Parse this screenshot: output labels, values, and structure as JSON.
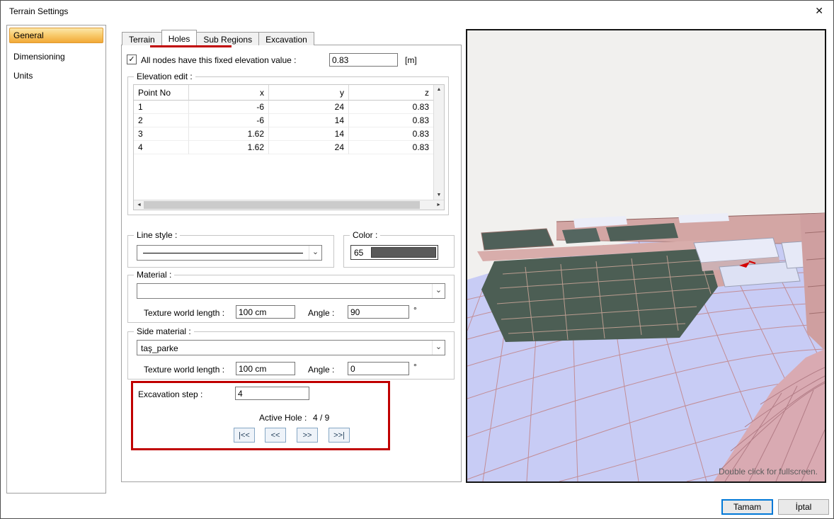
{
  "window": {
    "title": "Terrain Settings"
  },
  "icons": {
    "close": "✕",
    "check": "✓",
    "combo_arrow": "⌄",
    "scroll_up": "▲",
    "scroll_down": "▼",
    "scroll_left": "◄",
    "scroll_right": "►"
  },
  "colors": {
    "annotation_red": "#c00000",
    "color_swatch": "#5a5a5a",
    "sidebar_selected_orange": "#f2a937",
    "ok_button_focus_border": "#0078d7"
  },
  "sidebar": {
    "items": [
      {
        "label": "General",
        "selected": true
      },
      {
        "label": "Dimensioning",
        "selected": false
      },
      {
        "label": "Units",
        "selected": false
      }
    ]
  },
  "tabs": [
    {
      "label": "Terrain",
      "active": false
    },
    {
      "label": "Holes",
      "active": true
    },
    {
      "label": "Sub Regions",
      "active": false
    },
    {
      "label": "Excavation",
      "active": false
    }
  ],
  "fixed_elevation": {
    "label": "All nodes have this fixed elevation value :",
    "checked": true,
    "value": "0.83",
    "unit": "[m]"
  },
  "elevation_edit": {
    "legend": "Elevation edit :",
    "columns": [
      "Point No",
      "x",
      "y",
      "z"
    ],
    "rows": [
      [
        "1",
        "-6",
        "24",
        "0.83"
      ],
      [
        "2",
        "-6",
        "14",
        "0.83"
      ],
      [
        "3",
        "1.62",
        "14",
        "0.83"
      ],
      [
        "4",
        "1.62",
        "24",
        "0.83"
      ]
    ]
  },
  "line_style": {
    "legend": "Line style :"
  },
  "color": {
    "legend": "Color :",
    "value": "65",
    "swatch_hex": "#5a5a5a"
  },
  "material": {
    "legend": "Material :",
    "value": "",
    "texture_label": "Texture world length :",
    "texture_value": "100 cm",
    "angle_label": "Angle :",
    "angle_value": "90",
    "degree": "°"
  },
  "side_material": {
    "legend": "Side material :",
    "value": "taş_parke",
    "texture_label": "Texture world length :",
    "texture_value": "100 cm",
    "angle_label": "Angle :",
    "angle_value": "0",
    "degree": "°"
  },
  "excavation_nav": {
    "step_label": "Excavation step :",
    "step_value": "4",
    "active_hole_label": "Active Hole :",
    "active_hole_value": "4 / 9",
    "buttons": [
      "|<<",
      "<<",
      ">>",
      ">>|"
    ]
  },
  "preview": {
    "hint": "Double click for fullscreen."
  },
  "footer": {
    "ok": "Tamam",
    "cancel": "İptal"
  }
}
